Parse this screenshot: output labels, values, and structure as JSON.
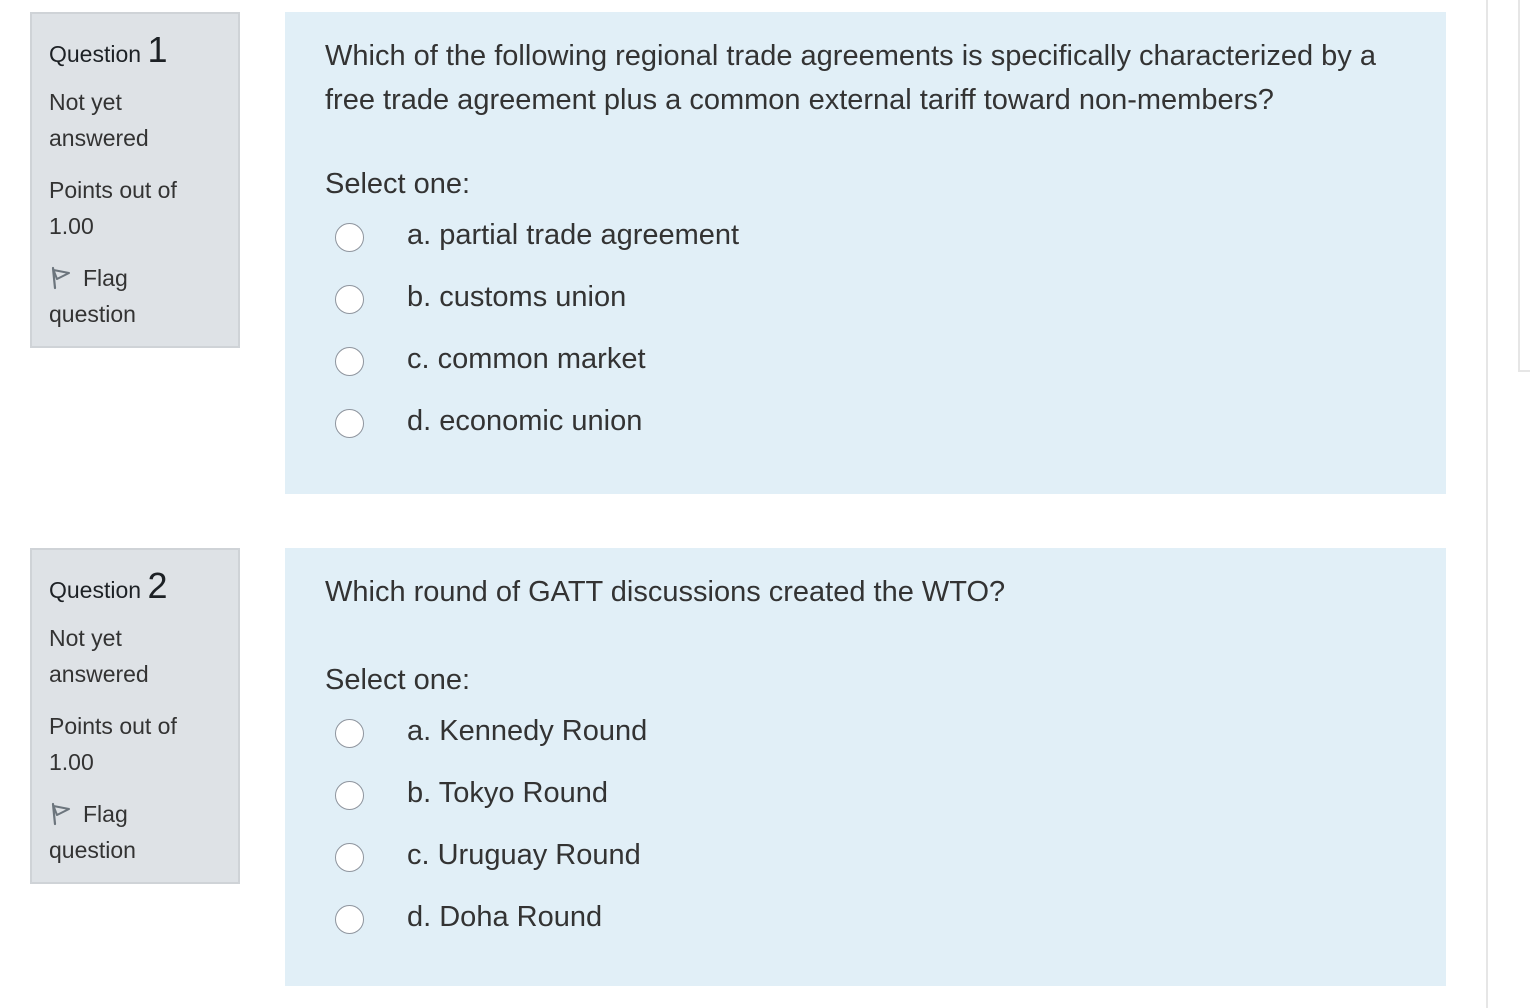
{
  "questions": [
    {
      "label": "Question",
      "number": "1",
      "state_line1": "Not yet",
      "state_line2": "answered",
      "grade_line1": "Points out of",
      "grade_line2": "1.00",
      "flag_line1": "Flag",
      "flag_line2": "question",
      "text": "Which of the following regional trade agreements is specifically characterized by a free trade agreement plus a common external tariff toward non-members?",
      "prompt": "Select one:",
      "options": [
        {
          "label": "a. partial trade agreement"
        },
        {
          "label": "b. customs union"
        },
        {
          "label": "c. common market"
        },
        {
          "label": "d. economic union"
        }
      ]
    },
    {
      "label": "Question",
      "number": "2",
      "state_line1": "Not yet",
      "state_line2": "answered",
      "grade_line1": "Points out of",
      "grade_line2": "1.00",
      "flag_line1": "Flag",
      "flag_line2": "question",
      "text": "Which round of GATT discussions created the WTO?",
      "prompt": "Select one:",
      "options": [
        {
          "label": "a. Kennedy Round"
        },
        {
          "label": "b. Tokyo Round"
        },
        {
          "label": "c. Uruguay Round"
        },
        {
          "label": "d. Doha Round"
        }
      ]
    }
  ],
  "icons": {
    "flag": "flag-icon"
  },
  "colors": {
    "info_bg": "#dee2e6",
    "content_bg": "#e1eff7",
    "text": "#333333"
  }
}
